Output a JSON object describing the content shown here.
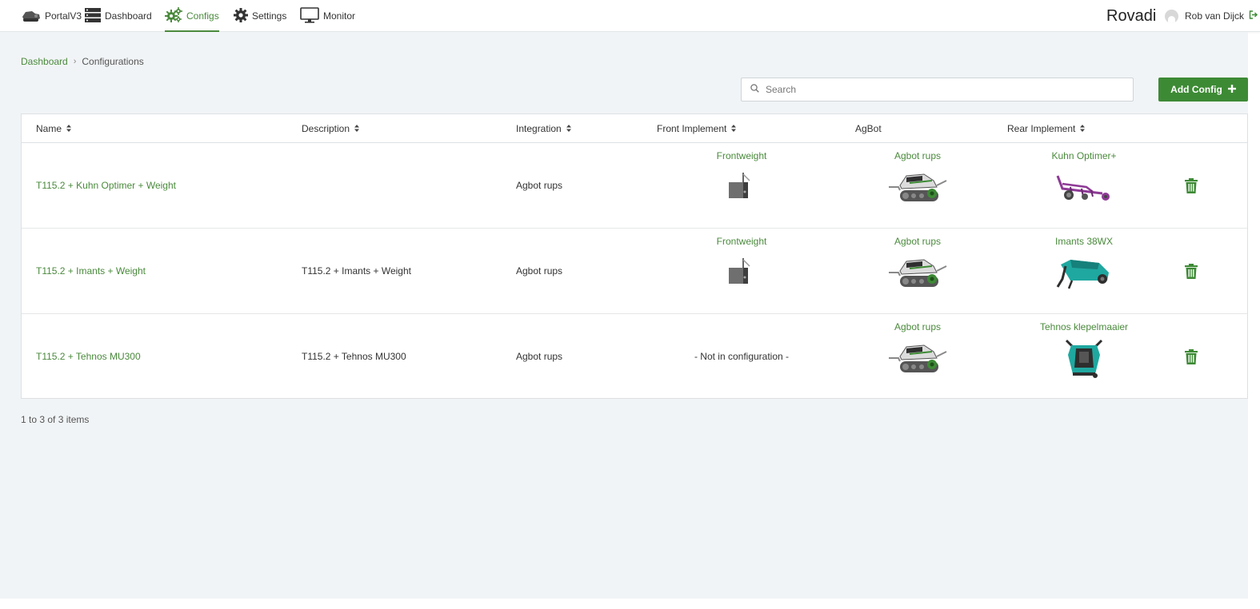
{
  "nav": {
    "items": [
      {
        "label": "PortalV3"
      },
      {
        "label": "Dashboard"
      },
      {
        "label": "Configs"
      },
      {
        "label": "Settings"
      },
      {
        "label": "Monitor"
      }
    ],
    "active": "Configs",
    "brand": "Rovadi",
    "user_name": "Rob van Dijck"
  },
  "breadcrumb": {
    "home": "Dashboard",
    "separator": "›",
    "current": "Configurations"
  },
  "toolbar": {
    "search_placeholder": "Search",
    "search_value": "",
    "add_label": "Add Config"
  },
  "table": {
    "columns": [
      {
        "label": "Name",
        "sortable": true
      },
      {
        "label": "Description",
        "sortable": true
      },
      {
        "label": "Integration",
        "sortable": true
      },
      {
        "label": "Front Implement",
        "sortable": true
      },
      {
        "label": "AgBot",
        "sortable": false
      },
      {
        "label": "Rear Implement",
        "sortable": true
      }
    ],
    "rows": [
      {
        "name": "T115.2 + Kuhn Optimer + Weight",
        "description": "",
        "integration": "Agbot rups",
        "front": {
          "label": "Frontweight",
          "icon": "frontweight-icon"
        },
        "agbot": {
          "label": "Agbot rups",
          "icon": "agbot-tracked-icon"
        },
        "rear": {
          "label": "Kuhn Optimer+",
          "icon": "kuhn-optimer-icon"
        }
      },
      {
        "name": "T115.2 + Imants + Weight",
        "description": "T115.2 + Imants + Weight",
        "integration": "Agbot rups",
        "front": {
          "label": "Frontweight",
          "icon": "frontweight-icon"
        },
        "agbot": {
          "label": "Agbot rups",
          "icon": "agbot-tracked-icon"
        },
        "rear": {
          "label": "Imants 38WX",
          "icon": "imants-spader-icon"
        }
      },
      {
        "name": "T115.2 + Tehnos MU300",
        "description": "T115.2 + Tehnos MU300",
        "integration": "Agbot rups",
        "front": {
          "label": "",
          "empty_text": "- Not in configuration -"
        },
        "agbot": {
          "label": "Agbot rups",
          "icon": "agbot-tracked-icon"
        },
        "rear": {
          "label": "Tehnos klepelmaaier",
          "icon": "tehnos-flail-mower-icon"
        }
      }
    ]
  },
  "pager": {
    "summary": "1 to 3 of 3 items"
  },
  "colors": {
    "accent": "#4a8a3c",
    "button": "#3d8a35",
    "background": "#f1f4f6"
  }
}
